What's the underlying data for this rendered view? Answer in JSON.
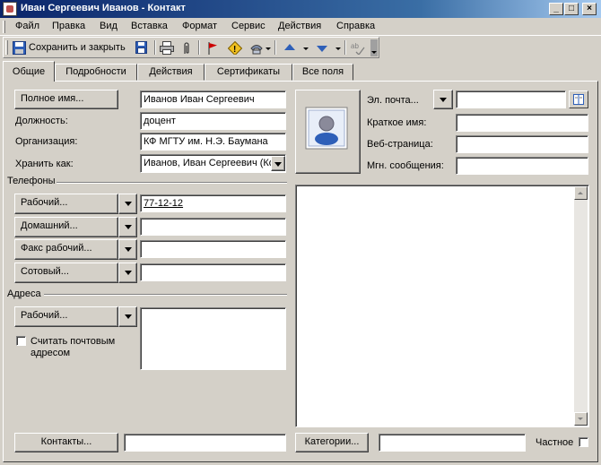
{
  "window": {
    "title": "Иван Сергеевич Иванов - Контакт"
  },
  "menu": [
    "Файл",
    "Правка",
    "Вид",
    "Вставка",
    "Формат",
    "Сервис",
    "Действия",
    "Справка"
  ],
  "toolbar": {
    "save_close_label": "Сохранить и закрыть"
  },
  "tabs": [
    "Общие",
    "Подробности",
    "Действия",
    "Сертификаты",
    "Все поля"
  ],
  "general": {
    "full_name_button": "Полное имя...",
    "full_name_value": "Иванов Иван Сергеевич",
    "job_title_label": "Должность:",
    "job_title_value": "доцент",
    "company_label": "Организация:",
    "company_value": "КФ МГТУ им. Н.Э. Баумана",
    "file_as_label": "Хранить как:",
    "file_as_value": "Иванов, Иван Сергеевич (Ко",
    "email_button": "Эл. почта...",
    "email_value": "",
    "display_name_label": "Краткое имя:",
    "display_name_value": "",
    "web_page_label": "Веб-страница:",
    "web_page_value": "",
    "im_label": "Мгн. сообщения:",
    "im_value": ""
  },
  "phones": {
    "group_label": "Телефоны",
    "items": [
      {
        "label": "Рабочий...",
        "value": "77-12-12"
      },
      {
        "label": "Домашний...",
        "value": ""
      },
      {
        "label": "Факс рабочий...",
        "value": ""
      },
      {
        "label": "Сотовый...",
        "value": ""
      }
    ]
  },
  "addresses": {
    "group_label": "Адреса",
    "type_button": "Рабочий...",
    "value": "",
    "mailing_checkbox_label": "Считать почтовым адресом",
    "mailing_checked": false
  },
  "notes": {
    "value": ""
  },
  "footer": {
    "contacts_button": "Контакты...",
    "contacts_value": "",
    "categories_button": "Категории...",
    "categories_value": "",
    "private_label": "Частное",
    "private_checked": false
  },
  "colors": {
    "title_bar": "#0a246a",
    "face": "#d4d0c8",
    "flag": "#cc0000",
    "arrow_blue": "#2e5fb8"
  }
}
